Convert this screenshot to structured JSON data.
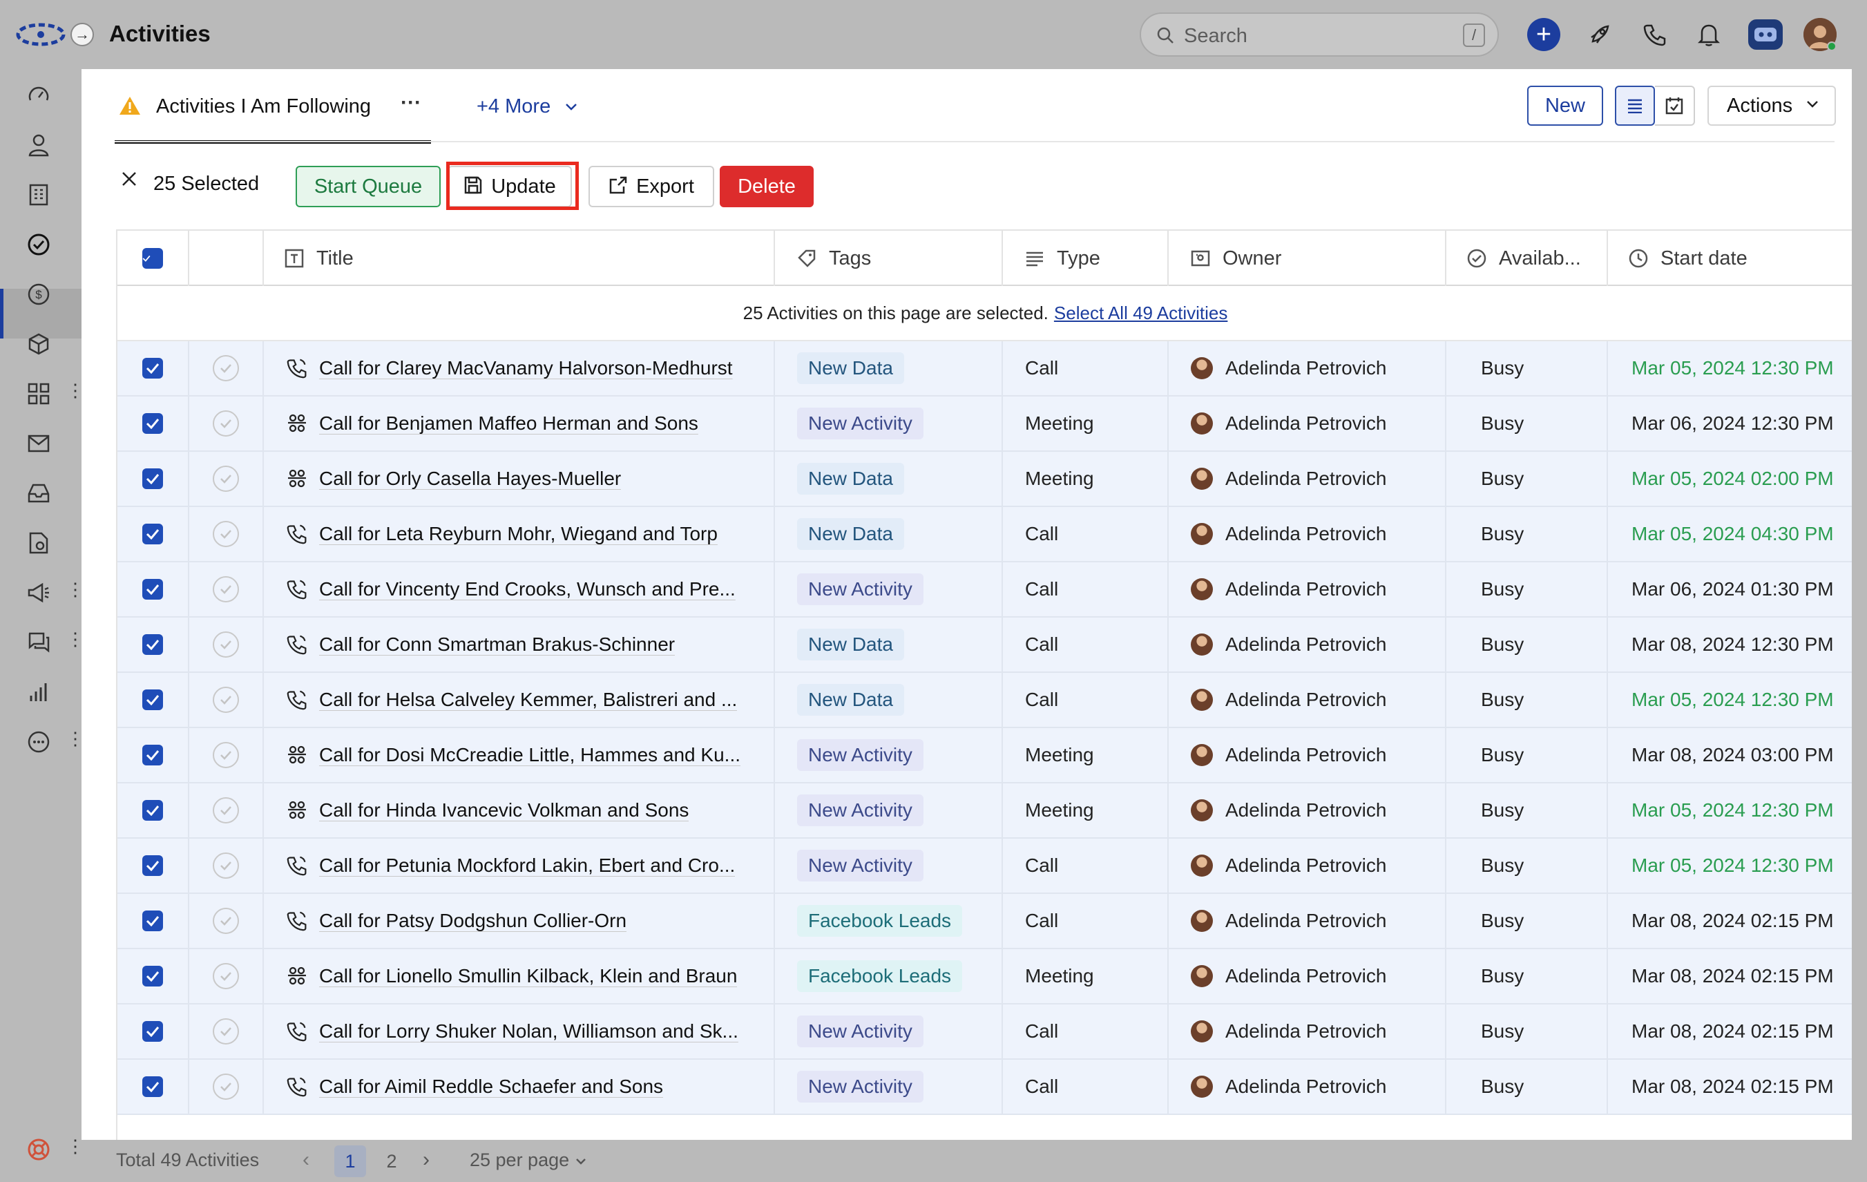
{
  "app": {
    "title": "Activities",
    "search_placeholder": "Search",
    "search_shortcut": "/"
  },
  "sidebar": {
    "items": [
      {
        "name": "dashboard-icon"
      },
      {
        "name": "contacts-icon"
      },
      {
        "name": "accounts-icon"
      },
      {
        "name": "activities-icon",
        "active": true
      },
      {
        "name": "deals-icon"
      },
      {
        "name": "products-icon"
      },
      {
        "name": "apps-icon",
        "more": true
      },
      {
        "name": "email-icon"
      },
      {
        "name": "inbox-icon"
      },
      {
        "name": "documents-icon"
      },
      {
        "name": "campaigns-icon",
        "more": true
      },
      {
        "name": "chat-icon",
        "more": true
      },
      {
        "name": "reports-icon"
      },
      {
        "name": "more-options-icon",
        "more": true
      },
      {
        "name": "help-icon",
        "more": true
      }
    ]
  },
  "view": {
    "name": "Activities I Am Following",
    "more_views": "+4 More",
    "new_label": "New",
    "actions_label": "Actions"
  },
  "bulk": {
    "selected": "25 Selected",
    "start_queue": "Start Queue",
    "update": "Update",
    "export": "Export",
    "delete": "Delete"
  },
  "table": {
    "columns": [
      "Title",
      "Tags",
      "Type",
      "Owner",
      "Availab...",
      "Start date"
    ],
    "selection_banner": "25 Activities on this page are selected.",
    "select_all_link": "Select All 49 Activities",
    "rows": [
      {
        "title": "Call for Clarey MacVanamy Halvorson-Medhurst",
        "icon": "call",
        "tag": "New Data",
        "type": "Call",
        "owner": "Adelinda Petrovich",
        "availability": "Busy",
        "start": "Mar 05, 2024 12:30 PM",
        "overdue": true
      },
      {
        "title": "Call for Benjamen Maffeo Herman and Sons",
        "icon": "meeting",
        "tag": "New Activity",
        "type": "Meeting",
        "owner": "Adelinda Petrovich",
        "availability": "Busy",
        "start": "Mar 06, 2024 12:30 PM",
        "overdue": false
      },
      {
        "title": "Call for Orly Casella Hayes-Mueller",
        "icon": "meeting",
        "tag": "New Data",
        "type": "Meeting",
        "owner": "Adelinda Petrovich",
        "availability": "Busy",
        "start": "Mar 05, 2024 02:00 PM",
        "overdue": true
      },
      {
        "title": "Call for Leta Reyburn Mohr, Wiegand and Torp",
        "icon": "call",
        "tag": "New Data",
        "type": "Call",
        "owner": "Adelinda Petrovich",
        "availability": "Busy",
        "start": "Mar 05, 2024 04:30 PM",
        "overdue": true
      },
      {
        "title": "Call for Vincenty End Crooks, Wunsch and Pre...",
        "icon": "call",
        "tag": "New Activity",
        "type": "Call",
        "owner": "Adelinda Petrovich",
        "availability": "Busy",
        "start": "Mar 06, 2024 01:30 PM",
        "overdue": false
      },
      {
        "title": "Call for Conn Smartman Brakus-Schinner",
        "icon": "call",
        "tag": "New Data",
        "type": "Call",
        "owner": "Adelinda Petrovich",
        "availability": "Busy",
        "start": "Mar 08, 2024 12:30 PM",
        "overdue": false
      },
      {
        "title": "Call for Helsa Calveley Kemmer, Balistreri and ...",
        "icon": "call",
        "tag": "New Data",
        "type": "Call",
        "owner": "Adelinda Petrovich",
        "availability": "Busy",
        "start": "Mar 05, 2024 12:30 PM",
        "overdue": true
      },
      {
        "title": "Call for Dosi McCreadie Little, Hammes and Ku...",
        "icon": "meeting",
        "tag": "New Activity",
        "type": "Meeting",
        "owner": "Adelinda Petrovich",
        "availability": "Busy",
        "start": "Mar 08, 2024 03:00 PM",
        "overdue": false
      },
      {
        "title": "Call for Hinda Ivancevic Volkman and Sons",
        "icon": "meeting",
        "tag": "New Activity",
        "type": "Meeting",
        "owner": "Adelinda Petrovich",
        "availability": "Busy",
        "start": "Mar 05, 2024 12:30 PM",
        "overdue": true
      },
      {
        "title": "Call for Petunia Mockford Lakin, Ebert and Cro...",
        "icon": "call",
        "tag": "New Activity",
        "type": "Call",
        "owner": "Adelinda Petrovich",
        "availability": "Busy",
        "start": "Mar 05, 2024 12:30 PM",
        "overdue": true
      },
      {
        "title": "Call for Patsy Dodgshun Collier-Orn",
        "icon": "call",
        "tag": "Facebook Leads",
        "type": "Call",
        "owner": "Adelinda Petrovich",
        "availability": "Busy",
        "start": "Mar 08, 2024 02:15 PM",
        "overdue": false
      },
      {
        "title": "Call for Lionello Smullin Kilback, Klein and Braun",
        "icon": "meeting",
        "tag": "Facebook Leads",
        "type": "Meeting",
        "owner": "Adelinda Petrovich",
        "availability": "Busy",
        "start": "Mar 08, 2024 02:15 PM",
        "overdue": false
      },
      {
        "title": "Call for Lorry Shuker Nolan, Williamson and Sk...",
        "icon": "call",
        "tag": "New Activity",
        "type": "Call",
        "owner": "Adelinda Petrovich",
        "availability": "Busy",
        "start": "Mar 08, 2024 02:15 PM",
        "overdue": false
      },
      {
        "title": "Call for Aimil Reddle Schaefer and Sons",
        "icon": "call",
        "tag": "New Activity",
        "type": "Call",
        "owner": "Adelinda Petrovich",
        "availability": "Busy",
        "start": "Mar 08, 2024 02:15 PM",
        "overdue": false
      }
    ]
  },
  "footer": {
    "total": "Total 49 Activities",
    "pages": [
      "1",
      "2"
    ],
    "current_page": "1",
    "per_page": "25 per page"
  },
  "colors": {
    "accent": "#1c3d9e",
    "checkbox": "#1f4db8",
    "overdue_date": "#2a9d50",
    "delete": "#dd2c2c",
    "start_queue": "#2e9e56",
    "highlight": "#ea2a1f"
  }
}
